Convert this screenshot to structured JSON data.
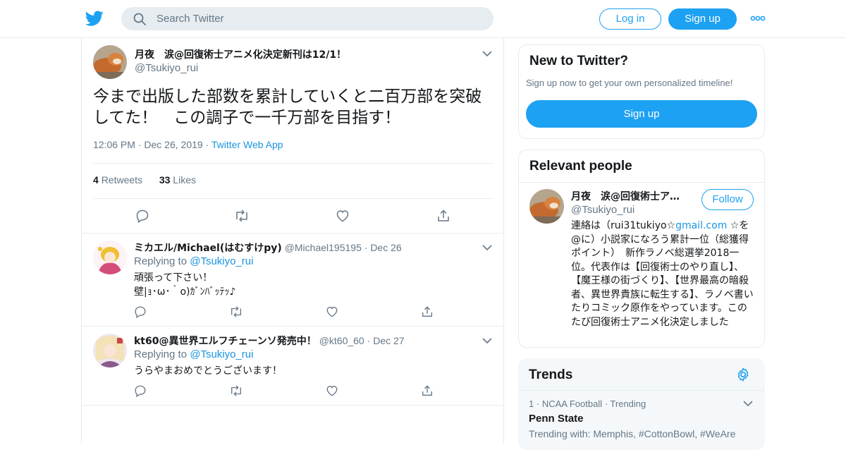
{
  "header": {
    "search_placeholder": "Search Twitter",
    "login_label": "Log in",
    "signup_label": "Sign up",
    "brand_color": "#1da1f2"
  },
  "tweet": {
    "author_name": "月夜　涙@回復術士アニメ化決定新刊は12/1！",
    "author_handle": "@Tsukiyo_rui",
    "text_line1": "今まで出版した部数を累計していくと二百万部を突破",
    "text_line2": "してた！　この調子で一千万部を目指す！",
    "time": "12:06 PM",
    "date": "Dec 26, 2019",
    "source": "Twitter Web App",
    "retweets_count": "4",
    "retweets_label": "Retweets",
    "likes_count": "33",
    "likes_label": "Likes"
  },
  "replies": [
    {
      "name": "ミカエル/Michael(はむすけpy)",
      "handle": "@Michael195195",
      "date": "Dec 26",
      "replying_prefix": "Replying to",
      "replying_to": "@Tsukiyo_rui",
      "line1": "頑張って下さい！",
      "line2": "壁|ｮ･ω･｀o)ｶﾞﾝﾊﾞｯﾃｯ♪"
    },
    {
      "name": "kt60@異世界エルフチェーンソ発売中！",
      "handle": "@kt60_60",
      "date": "Dec 27",
      "replying_prefix": "Replying to",
      "replying_to": "@Tsukiyo_rui",
      "line1": "うらやまおめでとうございます！"
    }
  ],
  "sidebar": {
    "new_to_twitter": {
      "title": "New to Twitter?",
      "subtitle": "Sign up now to get your own personalized timeline!",
      "button": "Sign up"
    },
    "relevant_people": {
      "title": "Relevant people",
      "name": "月夜　涙@回復術士ア…",
      "handle": "@Tsukiyo_rui",
      "follow_label": "Follow",
      "bio_prefix": "連絡は（rui31tukiyo☆",
      "bio_link": "gmail.com",
      "bio_rest": " ☆を@に）小説家になろう累計一位（総獲得ポイント）　新作ラノベ総選挙2018一位。代表作は【回復術士のやり直し】、【魔王様の街づくり】、【世界最高の暗殺者、異世界貴族に転生する】、ラノベ書いたりコミック原作をやっています。このたび回復術士アニメ化決定しました"
    },
    "trends": {
      "title": "Trends",
      "items": [
        {
          "rank": "1",
          "category": "NCAA Football",
          "status": "Trending",
          "name": "Penn State",
          "with_label": "Trending with:",
          "with_tags": "Memphis, #CottonBowl, #WeAre"
        }
      ]
    }
  }
}
